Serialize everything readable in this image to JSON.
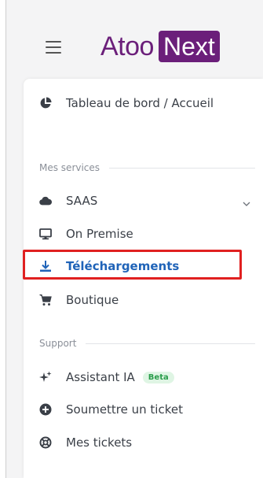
{
  "brand": {
    "part1": "Atoo",
    "part2": "Next",
    "color": "#6b1f7a"
  },
  "nav": {
    "dashboard": "Tableau de bord / Accueil",
    "sections": [
      {
        "title": "Mes services"
      },
      {
        "title": "Support"
      }
    ],
    "services": [
      {
        "label": "SAAS",
        "icon": "cloud-icon"
      },
      {
        "label": "On Premise",
        "icon": "monitor-icon"
      },
      {
        "label": "Téléchargements",
        "icon": "download-icon",
        "active": true
      },
      {
        "label": "Boutique",
        "icon": "cart-icon"
      }
    ],
    "support": [
      {
        "label": "Assistant IA",
        "icon": "sparkle-icon",
        "badge": "Beta"
      },
      {
        "label": "Soumettre un ticket",
        "icon": "plus-circle-icon"
      },
      {
        "label": "Mes tickets",
        "icon": "lifebuoy-icon"
      }
    ]
  },
  "colors": {
    "active": "#1f63b8",
    "highlight": "#e02020",
    "badge_bg": "#dff5e4",
    "badge_text": "#2a9d4b"
  }
}
